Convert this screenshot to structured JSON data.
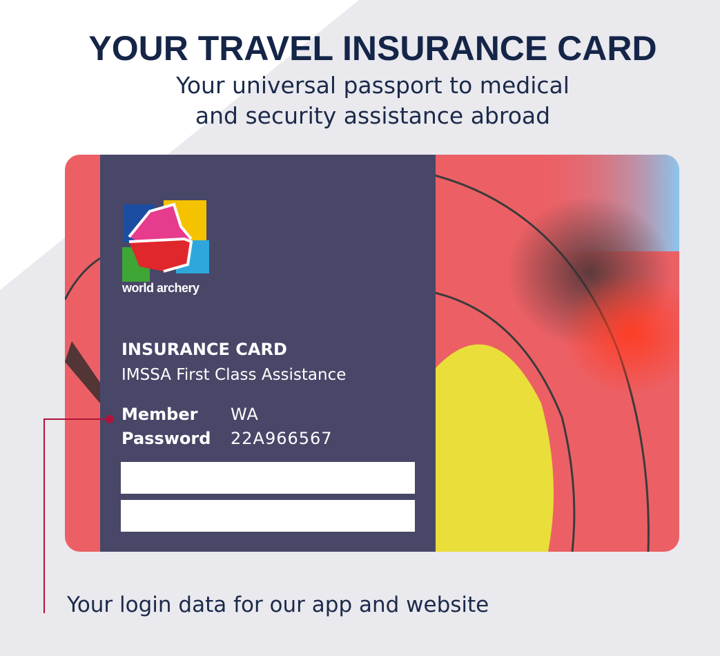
{
  "header": {
    "title": "YOUR TRAVEL INSURANCE CARD",
    "subtitle_line1": "Your universal passport to medical",
    "subtitle_line2": "and security assistance abroad"
  },
  "card": {
    "logo_text": "world archery",
    "heading": "INSURANCE CARD",
    "subheading": "IMSSA First Class Assistance",
    "member_label": "Member",
    "member_value": "WA",
    "password_label": "Password",
    "password_value": "22A966567",
    "fields": [
      "",
      ""
    ]
  },
  "caption": "Your login data for our app and website",
  "colors": {
    "navy_text": "#152548",
    "card_panel": "#484768",
    "accent_red": "#b0143a",
    "target_red": "#ec6065",
    "target_yellow": "#e9de3a",
    "background_band": "#e9e9ee"
  }
}
